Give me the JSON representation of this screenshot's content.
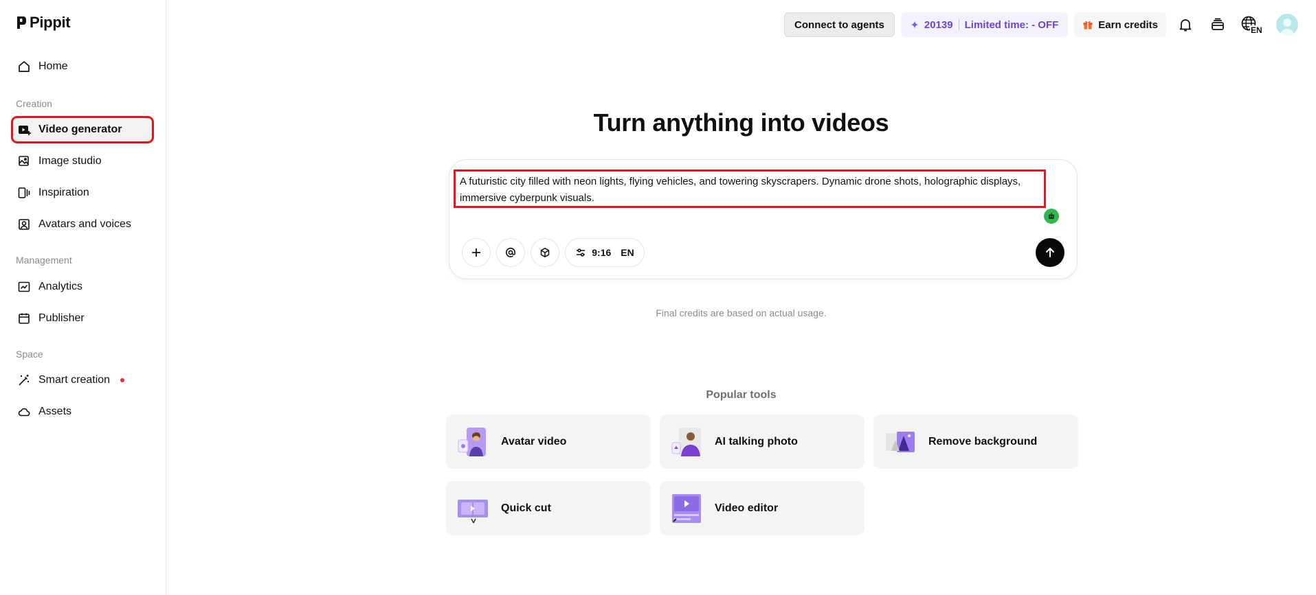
{
  "app": {
    "logo_text": "Pippit"
  },
  "sidebar": {
    "home": "Home",
    "sections": {
      "creation": "Creation",
      "management": "Management",
      "space": "Space"
    },
    "creation_items": [
      {
        "label": "Video generator",
        "icon": "video-generator-icon",
        "active": true
      },
      {
        "label": "Image studio",
        "icon": "image-studio-icon"
      },
      {
        "label": "Inspiration",
        "icon": "inspiration-icon"
      },
      {
        "label": "Avatars and voices",
        "icon": "avatar-voice-icon"
      }
    ],
    "management_items": [
      {
        "label": "Analytics",
        "icon": "analytics-icon"
      },
      {
        "label": "Publisher",
        "icon": "calendar-icon"
      }
    ],
    "space_items": [
      {
        "label": "Smart creation",
        "icon": "magic-wand-icon",
        "has_dot": true
      },
      {
        "label": "Assets",
        "icon": "cloud-icon"
      }
    ]
  },
  "topbar": {
    "connect_agents": "Connect to agents",
    "credits": "20139",
    "promo": "Limited time: - OFF",
    "earn_credits": "Earn credits",
    "language": "EN"
  },
  "main": {
    "headline": "Turn anything into videos",
    "prompt_value": "A futuristic city filled with neon lights, flying vehicles, and towering skyscrapers. Dynamic drone shots, holographic displays, immersive cyberpunk visuals.",
    "settings": {
      "ratio": "9:16",
      "language": "EN"
    },
    "credits_note": "Final credits are based on actual usage.",
    "popular_title": "Popular tools",
    "tools": [
      "Avatar video",
      "AI talking photo",
      "Remove background",
      "Quick cut",
      "Video editor"
    ]
  },
  "colors": {
    "accent_purple": "#6b45d9",
    "highlight_red": "#e8141b",
    "grammar_green": "#2fb84f"
  }
}
